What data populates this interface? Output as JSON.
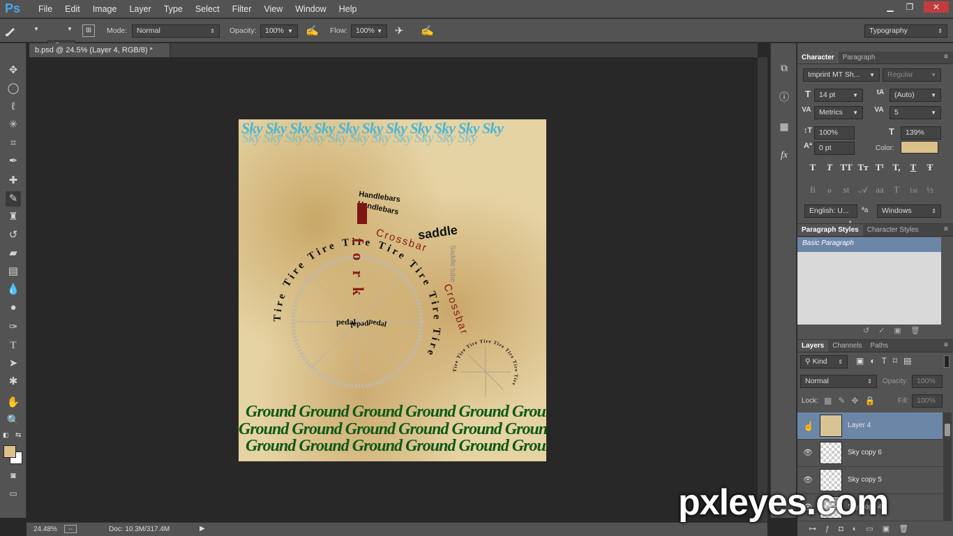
{
  "app": {
    "logo": "Ps"
  },
  "menu": [
    "File",
    "Edit",
    "Image",
    "Layer",
    "Type",
    "Select",
    "Filter",
    "View",
    "Window",
    "Help"
  ],
  "window_controls": {
    "minimize": "▁",
    "restore": "❐",
    "close": "✕"
  },
  "options": {
    "brush_size": "400",
    "mode_label": "Mode:",
    "mode_value": "Normal",
    "opacity_label": "Opacity:",
    "opacity_value": "100%",
    "flow_label": "Flow:",
    "flow_value": "100%",
    "workspace": "Typography"
  },
  "document_tab": {
    "title": "b.psd @ 24.5% (Layer 4, RGB/8) *",
    "close": "×"
  },
  "status": {
    "zoom": "24.48%",
    "doc": "Doc: 10.3M/317.4M"
  },
  "artwork": {
    "sky_word": "Sky",
    "handlebars": "Handlebars",
    "saddle": "saddle",
    "crossbar": "Crossbar",
    "saddle_tube": "Saddle tube",
    "fork": "fork",
    "tire": "Tire",
    "pedal": "pedal",
    "ground_word": "Ground",
    "sky_rows": [
      "Sky Sky Sky Sky Sky Sky Sky Sky Sky Sky Sky",
      "Sky Sky Sky Sky Sky Sky Sky Sky Sky Sky Sky"
    ],
    "ground_rows": [
      "Ground Ground Ground Ground Ground Ground",
      "Ground Ground Ground Ground Ground Ground",
      "Ground Ground Ground Ground Ground Ground"
    ]
  },
  "character_panel": {
    "tabs": [
      "Character",
      "Paragraph"
    ],
    "font_family": "Imprint MT Sh...",
    "font_style": "Regular",
    "font_size": "14 pt",
    "leading": "(Auto)",
    "kerning": "Metrics",
    "tracking": "5",
    "vertical_scale": "100%",
    "horizontal_scale": "139%",
    "baseline_shift": "0 pt",
    "color_label": "Color:",
    "color": "#dcc18a",
    "type_buttons_row1": [
      "T",
      "T",
      "TT",
      "Tт",
      "T¹",
      "T,",
      "T",
      "Ŧ"
    ],
    "type_buttons_row2": [
      "fi",
      "ℴ",
      "st",
      "𝒜",
      "aa",
      "T",
      "1st",
      "½"
    ],
    "language": "English: U...",
    "aa_label": "ªa",
    "antialias": "Windows"
  },
  "paragraph_styles": {
    "tabs": [
      "Paragraph Styles",
      "Character Styles"
    ],
    "items": [
      "Basic Paragraph"
    ]
  },
  "layers_panel": {
    "tabs": [
      "Layers",
      "Channels",
      "Paths"
    ],
    "filter": "Kind",
    "blend_mode": "Normal",
    "opacity_label": "Opacity:",
    "opacity_value": "100%",
    "lock_label": "Lock:",
    "fill_label": "Fill:",
    "fill_value": "100%",
    "layers": [
      {
        "name": "Layer 4",
        "selected": true
      },
      {
        "name": "Sky copy 6",
        "selected": false
      },
      {
        "name": "Sky copy 5",
        "selected": false
      },
      {
        "name": "Sky copy 4",
        "selected": false
      }
    ]
  },
  "watermark": "pxleyes.com",
  "colors": {
    "accent": "#49a6e9",
    "selected_layer": "#6c86a8",
    "fg_swatch": "#dcc18a",
    "bg_swatch": "#ffffff"
  }
}
